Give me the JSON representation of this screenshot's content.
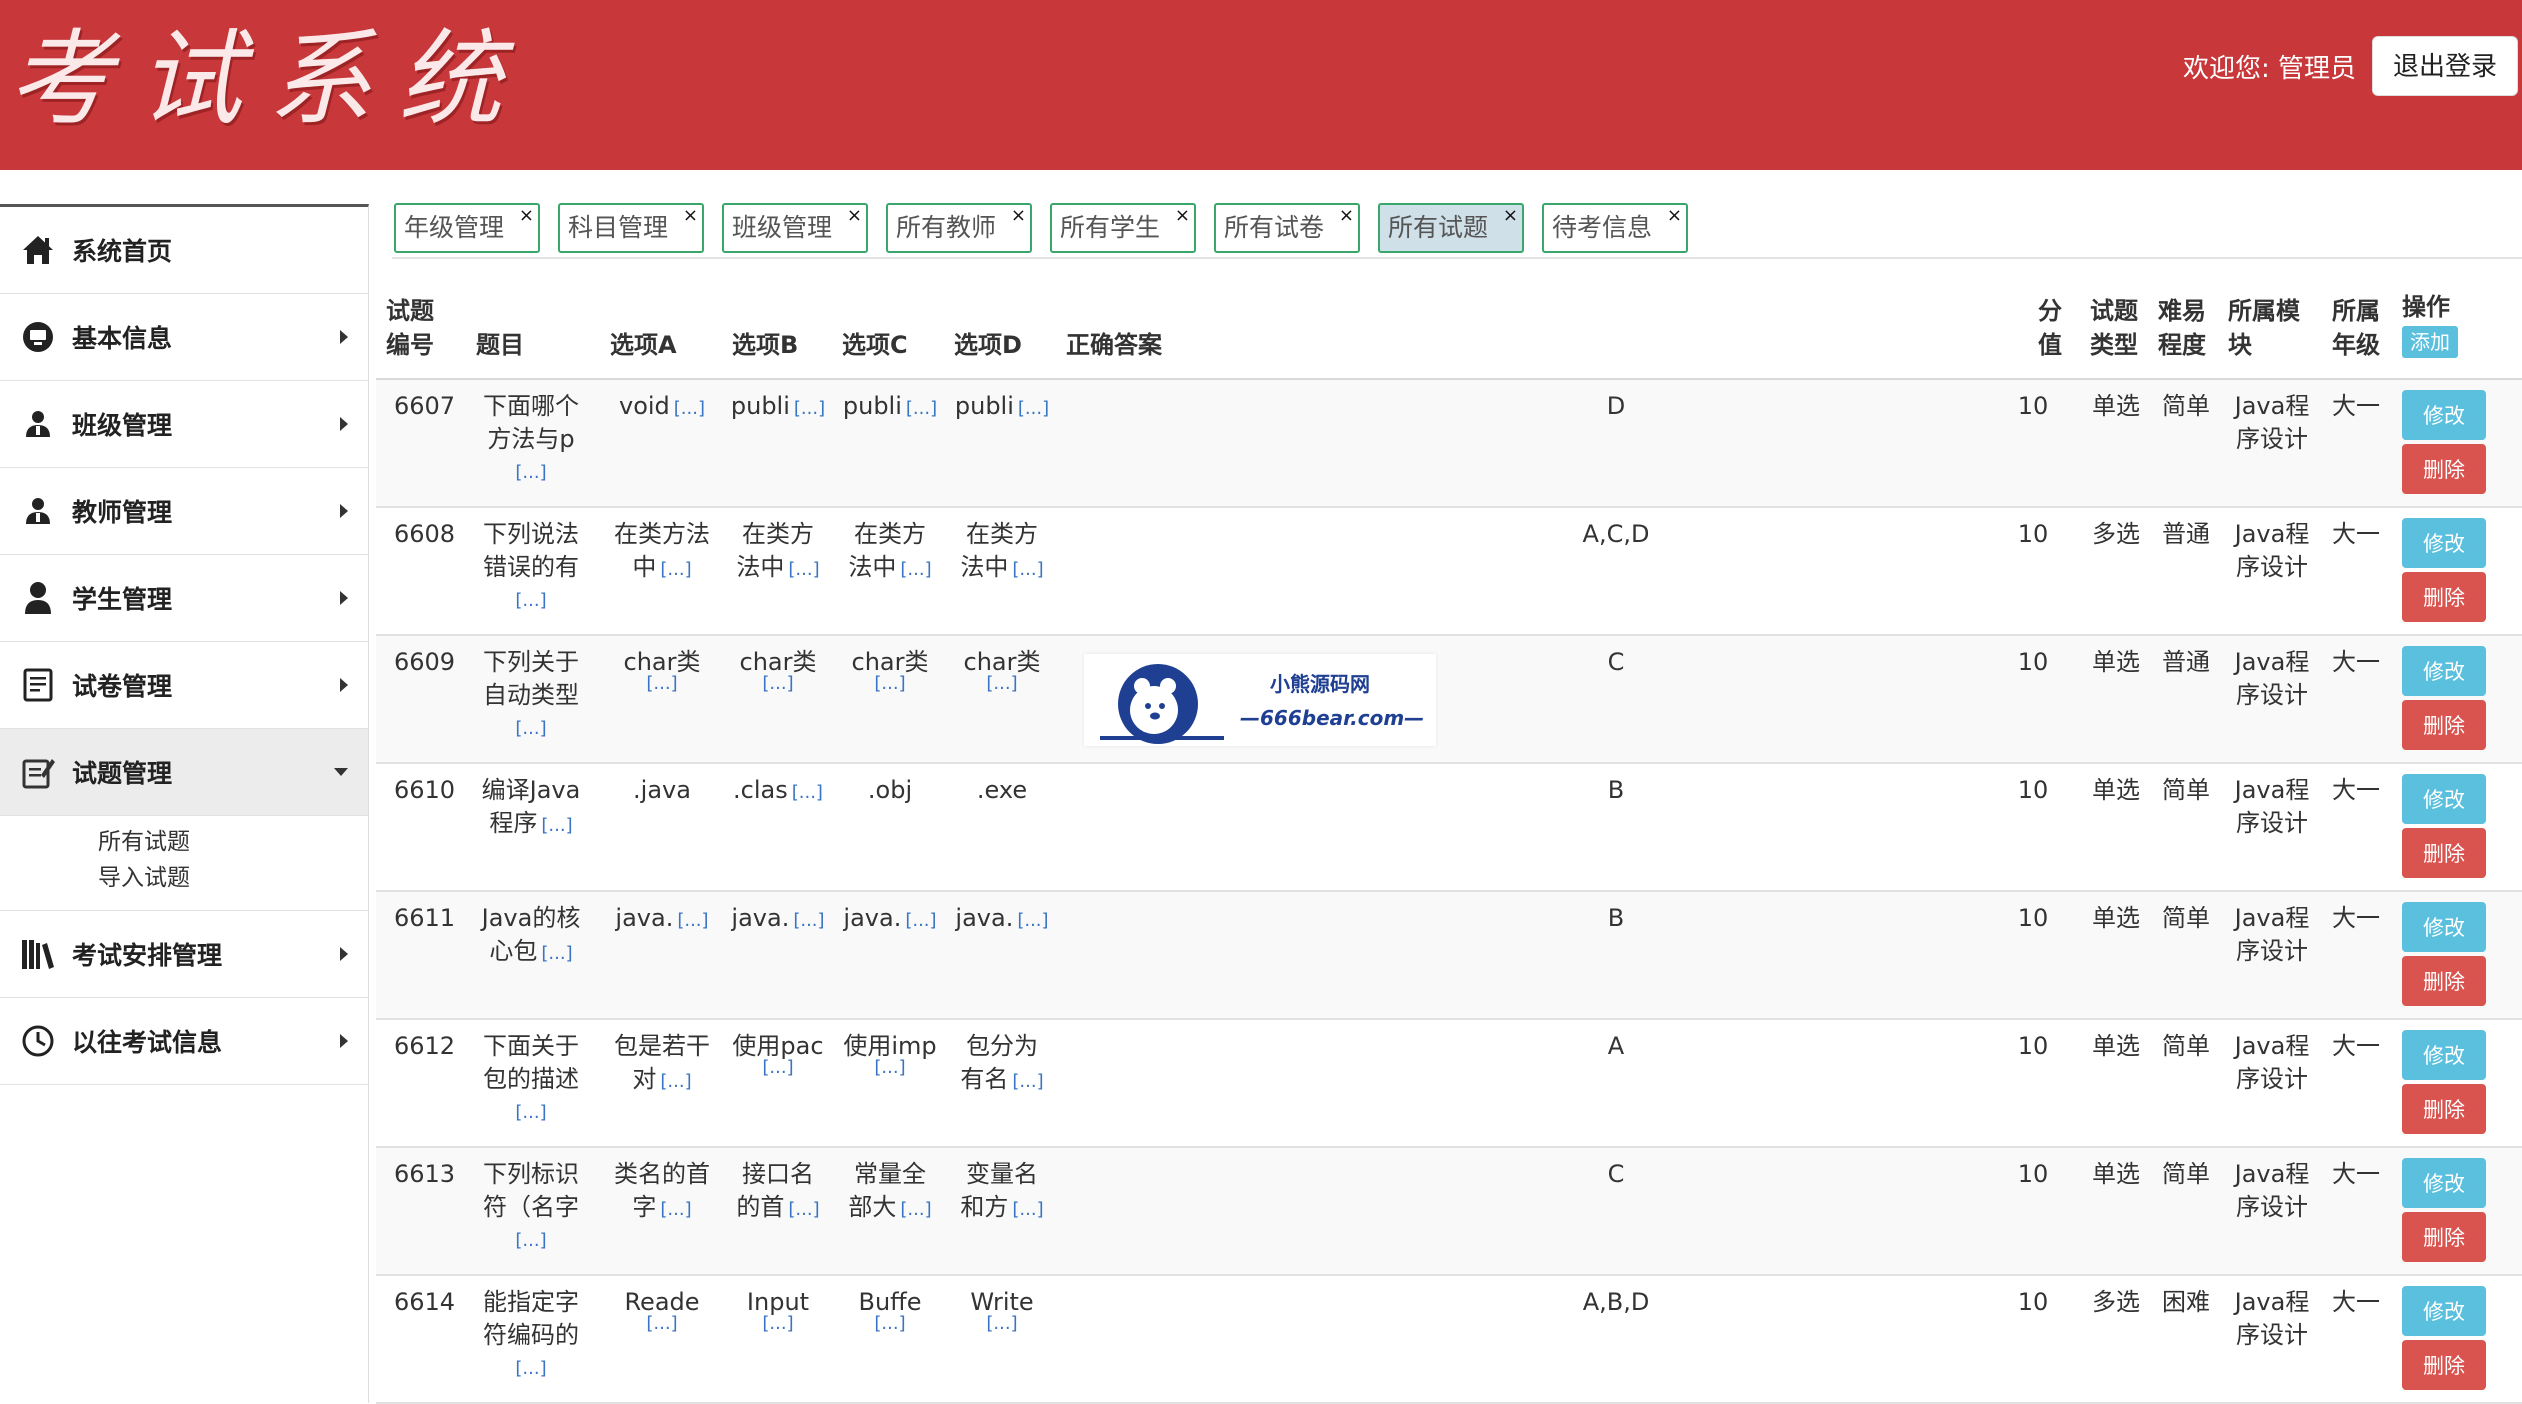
{
  "header": {
    "logo_text": "考试系统",
    "welcome": "欢迎您: 管理员",
    "logout_label": "退出登录",
    "bg_color": "#c8373a"
  },
  "sidebar": {
    "items": [
      {
        "label": "系统首页",
        "icon": "home-icon"
      },
      {
        "label": "基本信息",
        "icon": "monitor-icon"
      },
      {
        "label": "班级管理",
        "icon": "users-icon"
      },
      {
        "label": "教师管理",
        "icon": "users-icon"
      },
      {
        "label": "学生管理",
        "icon": "user-icon"
      },
      {
        "label": "试卷管理",
        "icon": "document-icon"
      },
      {
        "label": "试题管理",
        "icon": "edit-document-icon"
      },
      {
        "label": "考试安排管理",
        "icon": "books-icon"
      },
      {
        "label": "以往考试信息",
        "icon": "clock-icon"
      }
    ],
    "sub_items": [
      "所有试题",
      "导入试题"
    ]
  },
  "tabs": [
    {
      "label": "年级管理"
    },
    {
      "label": "科目管理"
    },
    {
      "label": "班级管理"
    },
    {
      "label": "所有教师"
    },
    {
      "label": "所有学生"
    },
    {
      "label": "所有试卷"
    },
    {
      "label": "所有试题"
    },
    {
      "label": "待考信息"
    }
  ],
  "table": {
    "headers": {
      "id_l1": "试题",
      "id_l2": "编号",
      "title": "题目",
      "a": "选项A",
      "b": "选项B",
      "c": "选项C",
      "d": "选项D",
      "answer": "正确答案",
      "score_l1": "分",
      "score_l2": "值",
      "type_l1": "试题",
      "type_l2": "类型",
      "diff_l1": "难易",
      "diff_l2": "程度",
      "module_l1": "所属模",
      "module_l2": "块",
      "grade_l1": "所属",
      "grade_l2": "年级",
      "ops": "操作",
      "add_label": "添加"
    },
    "more_label": "[...]",
    "edit_label": "修改",
    "delete_label": "删除",
    "rows": [
      {
        "id": "6607",
        "t1": "下面哪个",
        "t2": "方法与p",
        "a1": "void",
        "a2": "",
        "b1": "publi",
        "b2": "",
        "c1": "publi",
        "c2": "",
        "d1": "publi",
        "d2": "",
        "answer": "D",
        "score": "10",
        "type": "单选",
        "diff": "简单",
        "m1": "Java程",
        "m2": "序设计",
        "grade": "大一"
      },
      {
        "id": "6608",
        "t1": "下列说法",
        "t2": "错误的有",
        "a1": "在类方法",
        "a2": "中",
        "b1": "在类方",
        "b2": "法中",
        "c1": "在类方",
        "c2": "法中",
        "d1": "在类方",
        "d2": "法中",
        "answer": "A,C,D",
        "score": "10",
        "type": "多选",
        "diff": "普通",
        "m1": "Java程",
        "m2": "序设计",
        "grade": "大一"
      },
      {
        "id": "6609",
        "t1": "下列关于",
        "t2": "自动类型",
        "a1": "char类",
        "a2": "",
        "b1": "char类",
        "b2": "",
        "c1": "char类",
        "c2": "",
        "d1": "char类",
        "d2": "",
        "answer": "C",
        "score": "10",
        "type": "单选",
        "diff": "普通",
        "m1": "Java程",
        "m2": "序设计",
        "grade": "大一"
      },
      {
        "id": "6610",
        "t1": "编译Java",
        "t2": "程序",
        "a1": ".java",
        "a2": "",
        "b1": ".clas",
        "b2": "",
        "c1": ".obj",
        "c2": "",
        "d1": ".exe",
        "d2": "",
        "answer": "B",
        "score": "10",
        "type": "单选",
        "diff": "简单",
        "m1": "Java程",
        "m2": "序设计",
        "grade": "大一"
      },
      {
        "id": "6611",
        "t1": "Java的核",
        "t2": "心包",
        "a1": "java.",
        "a2": "",
        "b1": "java.",
        "b2": "",
        "c1": "java.",
        "c2": "",
        "d1": "java.",
        "d2": "",
        "answer": "B",
        "score": "10",
        "type": "单选",
        "diff": "简单",
        "m1": "Java程",
        "m2": "序设计",
        "grade": "大一"
      },
      {
        "id": "6612",
        "t1": "下面关于",
        "t2": "包的描述",
        "a1": "包是若干",
        "a2": "对",
        "b1": "使用pac",
        "b2": "",
        "c1": "使用imp",
        "c2": "",
        "d1": "包分为",
        "d2": "有名",
        "answer": "A",
        "score": "10",
        "type": "单选",
        "diff": "简单",
        "m1": "Java程",
        "m2": "序设计",
        "grade": "大一"
      },
      {
        "id": "6613",
        "t1": "下列标识",
        "t2": "符（名字",
        "a1": "类名的首",
        "a2": "字",
        "b1": "接口名",
        "b2": "的首",
        "c1": "常量全",
        "c2": "部大",
        "d1": "变量名",
        "d2": "和方",
        "answer": "C",
        "score": "10",
        "type": "单选",
        "diff": "简单",
        "m1": "Java程",
        "m2": "序设计",
        "grade": "大一"
      },
      {
        "id": "6614",
        "t1": "能指定字",
        "t2": "符编码的",
        "a1": "Reade",
        "a2": "",
        "b1": "Input",
        "b2": "",
        "c1": "Buffe",
        "c2": "",
        "d1": "Write",
        "d2": "",
        "answer": "A,B,D",
        "score": "10",
        "type": "多选",
        "diff": "困难",
        "m1": "Java程",
        "m2": "序设计",
        "grade": "大一"
      }
    ]
  },
  "watermark": {
    "line1": "小熊源码网",
    "line2": "—666bear.com—"
  },
  "colors": {
    "edit_button": "#5bc0de",
    "delete_button": "#d9534f",
    "tab_border": "#3aa66b",
    "active_tab_bg": "#cfe0e8",
    "link_more": "#3a74c4"
  }
}
